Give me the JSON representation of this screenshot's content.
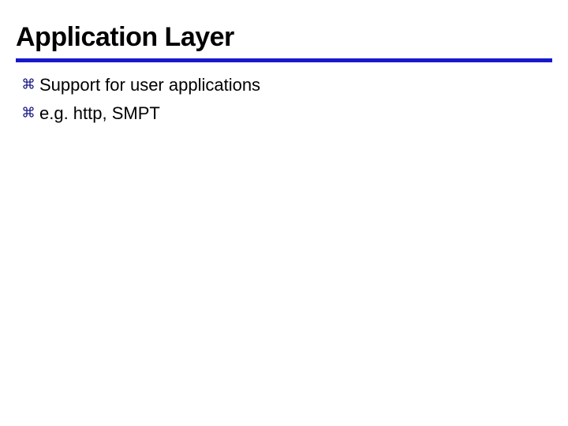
{
  "slide": {
    "title": "Application Layer",
    "bullets": [
      {
        "text": "Support for user applications"
      },
      {
        "text": "e.g. http, SMPT"
      }
    ]
  },
  "colors": {
    "underline": "#1818cc",
    "bullet": "#181888"
  }
}
